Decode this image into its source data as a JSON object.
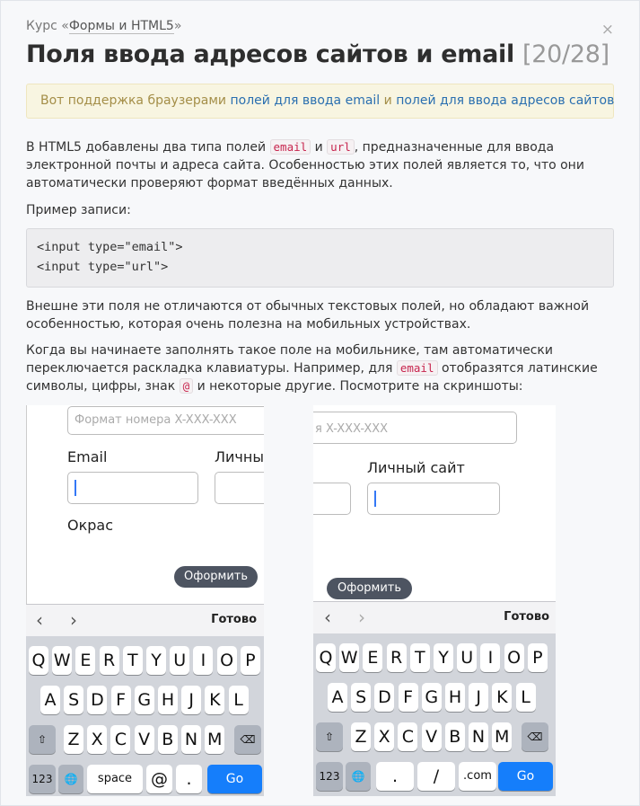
{
  "header": {
    "course_prefix": "Курс «",
    "course_link": "Формы и HTML5",
    "course_suffix": "»",
    "close": "×"
  },
  "title": {
    "text": "Поля ввода адресов сайтов и email",
    "counter": "[20/28]"
  },
  "note": {
    "text": "Вот поддержка браузерами ",
    "link1": "полей для ввода email",
    "and": " и ",
    "link2": "полей для ввода адресов сайтов"
  },
  "p1": {
    "a": "В HTML5 добавлены два типа полей ",
    "code1": "email",
    "b": " и ",
    "code2": "url",
    "c": ", предназначенные для ввода электронной почты и адреса сайта. Особенностью этих полей является то, что они автоматически проверяют формат введённых данных."
  },
  "p2": "Пример записи:",
  "code": {
    "line1": "<input type=\"email\">",
    "line2": "<input type=\"url\">"
  },
  "p3": "Внешне эти поля не отличаются от обычных текстовых полей, но обладают важной особенностью, которая очень полезна на мобильных устройствах.",
  "p4": {
    "a": "Когда вы начинаете заполнять такое поле на мобильнике, там автоматически переключается раскладка клавиатуры. Например, для ",
    "code1": "email",
    "b": " отобразятся латинские символы, цифры, знак ",
    "code2": "@",
    "c": " и некоторые другие. Посмотрите на скриншоты:"
  },
  "shot1": {
    "placeholder": "Формат номера X-XXX-XXX",
    "label_email": "Email",
    "label_site": "Личный",
    "label_color": "Окрас",
    "order": "Оформить",
    "prev": "‹",
    "next": "›",
    "done": "Готово",
    "row1": [
      "Q",
      "W",
      "E",
      "R",
      "T",
      "Y",
      "U",
      "I",
      "O",
      "P"
    ],
    "row2": [
      "A",
      "S",
      "D",
      "F",
      "G",
      "H",
      "J",
      "K",
      "L"
    ],
    "row3": [
      "Z",
      "X",
      "C",
      "V",
      "B",
      "N",
      "M"
    ],
    "shift": "⇧",
    "del": "⌫",
    "num": "123",
    "globe": "🌐",
    "space": "space",
    "at": "@",
    "dot": ".",
    "go": "Go"
  },
  "shot2": {
    "placeholder": "я X-XXX-XXX",
    "label_site": "Личный сайт",
    "order": "Оформить",
    "prev": "‹",
    "next": "›",
    "done": "Готово",
    "row1": [
      "Q",
      "W",
      "E",
      "R",
      "T",
      "Y",
      "U",
      "I",
      "O",
      "P"
    ],
    "row2": [
      "A",
      "S",
      "D",
      "F",
      "G",
      "H",
      "J",
      "K",
      "L"
    ],
    "row3": [
      "Z",
      "X",
      "C",
      "V",
      "B",
      "N",
      "M"
    ],
    "shift": "⇧",
    "del": "⌫",
    "num": "123",
    "globe": "🌐",
    "dot": ".",
    "slash": "/",
    "com": ".com",
    "go": "Go"
  }
}
